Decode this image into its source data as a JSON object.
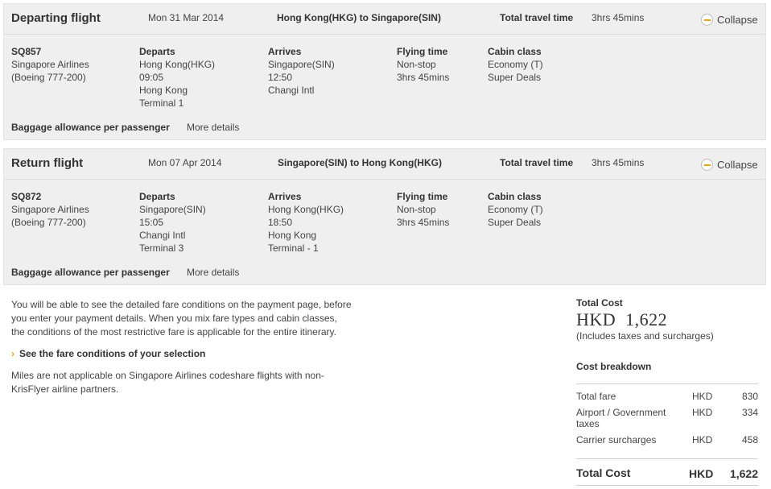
{
  "departing": {
    "title": "Departing flight",
    "date": "Mon 31 Mar 2014",
    "route": "Hong Kong(HKG) to Singapore(SIN)",
    "total_travel_label": "Total travel time",
    "total_travel_value": "3hrs 45mins",
    "collapse_label": "Collapse",
    "flight_no": "SQ857",
    "airline": "Singapore Airlines",
    "aircraft": "(Boeing 777-200)",
    "departs_label": "Departs",
    "departs_airport": "Hong Kong(HKG)",
    "departs_time": "09:05",
    "departs_city": "Hong Kong",
    "departs_terminal": "Terminal 1",
    "arrives_label": "Arrives",
    "arrives_airport": "Singapore(SIN)",
    "arrives_time": "12:50",
    "arrives_city": "Changi Intl",
    "flying_label": "Flying time",
    "flying_stops": "Non-stop",
    "flying_duration": "3hrs 45mins",
    "cabin_label": "Cabin class",
    "cabin_class": "Economy (T)",
    "cabin_fare": "Super Deals",
    "baggage_label": "Baggage allowance per passenger",
    "more_details": "More details"
  },
  "return": {
    "title": "Return flight",
    "date": "Mon 07 Apr 2014",
    "route": "Singapore(SIN) to Hong Kong(HKG)",
    "total_travel_label": "Total travel time",
    "total_travel_value": "3hrs 45mins",
    "collapse_label": "Collapse",
    "flight_no": "SQ872",
    "airline": "Singapore Airlines",
    "aircraft": "(Boeing 777-200)",
    "departs_label": "Departs",
    "departs_airport": "Singapore(SIN)",
    "departs_time": "15:05",
    "departs_city": "Changi Intl",
    "departs_terminal": "Terminal 3",
    "arrives_label": "Arrives",
    "arrives_airport": "Hong Kong(HKG)",
    "arrives_time": "18:50",
    "arrives_city": "Hong Kong",
    "arrives_terminal": "Terminal - 1",
    "flying_label": "Flying time",
    "flying_stops": "Non-stop",
    "flying_duration": "3hrs 45mins",
    "cabin_label": "Cabin class",
    "cabin_class": "Economy (T)",
    "cabin_fare": "Super Deals",
    "baggage_label": "Baggage allowance per passenger",
    "more_details": "More details"
  },
  "info": {
    "fare_text_1": "You will be able to see the detailed fare conditions on the payment page, before",
    "fare_text_2": "you enter your payment details. When you mix fare types and cabin classes,",
    "fare_text_3": "the conditions of the most restrictive fare is applicable for the entire itinerary.",
    "fare_link": "See the fare conditions of your selection",
    "miles_text_1": "Miles are not applicable on Singapore Airlines codeshare flights with non-",
    "miles_text_2": "KrisFlyer airline partners."
  },
  "cost": {
    "total_label": "Total Cost",
    "total_amount": "HKD  1,622",
    "total_note": "(Includes taxes and surcharges)",
    "breakdown_label": "Cost breakdown",
    "rows": [
      {
        "name": "Total fare",
        "currency": "HKD",
        "value": "830"
      },
      {
        "name": "Airport / Government taxes",
        "currency": "HKD",
        "value": "334"
      },
      {
        "name": "Carrier surcharges",
        "currency": "HKD",
        "value": "458"
      }
    ],
    "grand_label": "Total Cost",
    "grand_currency": "HKD",
    "grand_value": "1,622"
  },
  "colors": {
    "panel_bg": "#efefef",
    "accent": "#f4a200",
    "text": "#333333"
  }
}
